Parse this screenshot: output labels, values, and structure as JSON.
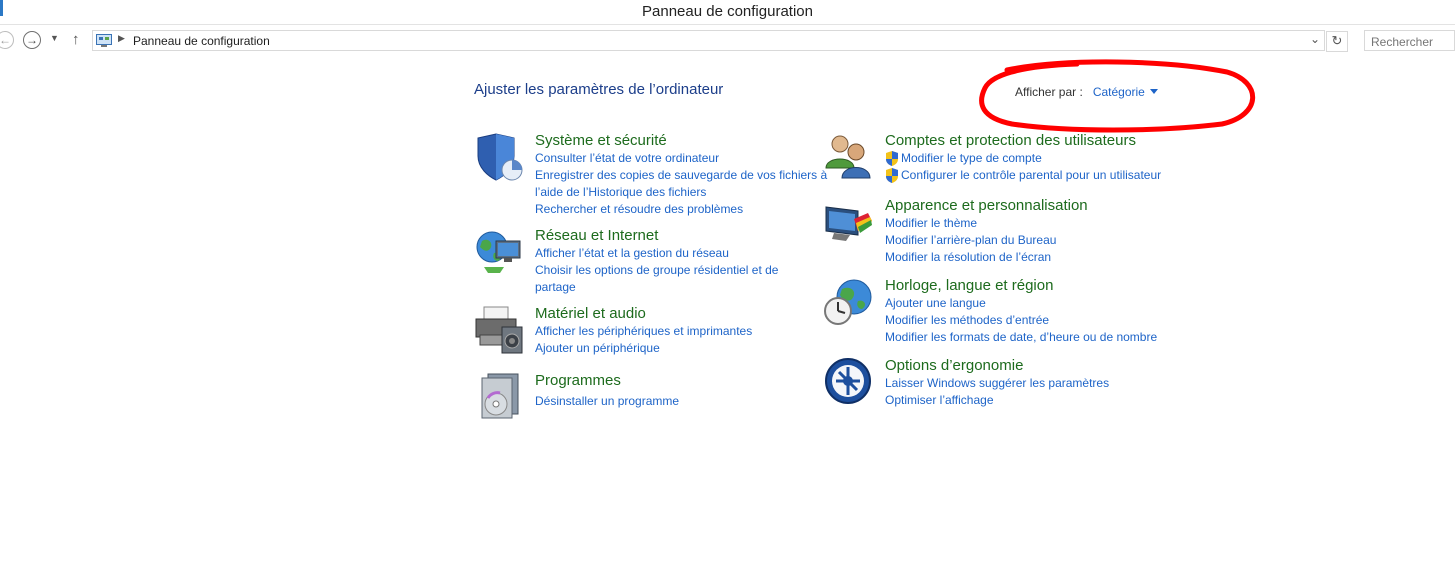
{
  "window": {
    "title": "Panneau de configuration"
  },
  "address": {
    "path": "Panneau de configuration"
  },
  "search": {
    "placeholder": "Rechercher"
  },
  "header": {
    "title": "Ajuster les paramètres de l’ordinateur"
  },
  "view_by": {
    "label": "Afficher par :",
    "value": "Catégorie"
  },
  "annotation": {
    "color": "#ff0000"
  },
  "colors": {
    "category_title": "#1d6b1d",
    "link": "#1e64c8",
    "heading": "#1c3e8a"
  },
  "categories": [
    {
      "title": "Système et sécurité",
      "icon": "shield-security-icon",
      "links": [
        "Consulter l’état de votre ordinateur",
        "Enregistrer des copies de sauvegarde de vos fichiers à",
        "l’aide de l’Historique des fichiers",
        "Rechercher et résoudre des problèmes"
      ]
    },
    {
      "title": "Réseau et Internet",
      "icon": "network-globe-icon",
      "links": [
        "Afficher l’état et la gestion du réseau",
        "Choisir les options de groupe résidentiel et de",
        "partage"
      ]
    },
    {
      "title": "Matériel et audio",
      "icon": "printer-speaker-icon",
      "links": [
        "Afficher les périphériques et imprimantes",
        "Ajouter un périphérique"
      ]
    },
    {
      "title": "Programmes",
      "icon": "programs-disc-icon",
      "links": [
        "Désinstaller un programme"
      ]
    },
    {
      "title": "Comptes et protection des utilisateurs",
      "icon": "users-icon",
      "links": [
        "Modifier le type de compte",
        "Configurer le contrôle parental pour un utilisateur"
      ]
    },
    {
      "title": "Apparence et personnalisation",
      "icon": "monitor-palette-icon",
      "links": [
        "Modifier le thème",
        "Modifier l’arrière-plan du Bureau",
        "Modifier la résolution de l’écran"
      ]
    },
    {
      "title": "Horloge, langue et région",
      "icon": "globe-clock-icon",
      "links": [
        "Ajouter une langue",
        "Modifier les méthodes d’entrée",
        "Modifier les formats de date, d’heure ou de nombre"
      ]
    },
    {
      "title": "Options d’ergonomie",
      "icon": "ease-of-access-icon",
      "links": [
        "Laisser Windows suggérer les paramètres",
        "Optimiser l’affichage"
      ]
    }
  ]
}
